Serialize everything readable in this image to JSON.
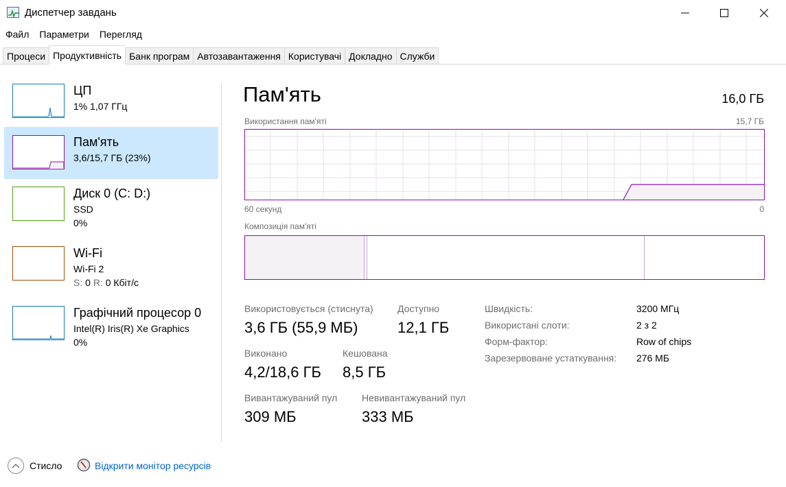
{
  "window": {
    "title": "Диспетчер завдань",
    "icon": "task-manager-icon"
  },
  "menu": [
    "Файл",
    "Параметри",
    "Перегляд"
  ],
  "tabs": [
    "Процеси",
    "Продуктивність",
    "Банк програм",
    "Автозавантаження",
    "Користувачі",
    "Докладно",
    "Служби"
  ],
  "active_tab": "Продуктивність",
  "sidebar": {
    "items": [
      {
        "title": "ЦП",
        "line1": "1%  1,07 ГГц",
        "line2": "",
        "color": "#117dbb",
        "selected": false
      },
      {
        "title": "Пам'ять",
        "line1": "3,6/15,7 ГБ (23%)",
        "line2": "",
        "color": "#8b12ae",
        "selected": true
      },
      {
        "title": "Диск 0 (C: D:)",
        "line1": "SSD",
        "line2": "0%",
        "color": "#4da60c",
        "selected": false
      },
      {
        "title": "Wi-Fi",
        "line1": "Wi-Fi 2",
        "line2_s": "S:",
        "line2_s_val": "0",
        "line2_r": "R:",
        "line2_r_val": "0 Кбіт/с",
        "color": "#a74f01",
        "selected": false
      },
      {
        "title": "Графічний процесор 0",
        "line1": "Intel(R) Iris(R) Xe Graphics",
        "line2": "0%",
        "color": "#117dbb",
        "selected": false
      }
    ]
  },
  "main": {
    "title": "Пам'ять",
    "total": "16,0 ГБ",
    "usage_label": "Використання пам'яті",
    "usage_max": "15,7 ГБ",
    "time_left": "60 секунд",
    "time_right": "0",
    "composition_label": "Композиція пам'яті",
    "accent_color": "#8b12ae"
  },
  "stats": {
    "in_use_label": "Використовується (стиснута)",
    "in_use_value": "3,6 ГБ (55,9 МБ)",
    "available_label": "Доступно",
    "available_value": "12,1 ГБ",
    "committed_label": "Виконано",
    "committed_value": "4,2/18,6 ГБ",
    "cached_label": "Кешована",
    "cached_value": "8,5 ГБ",
    "paged_label": "Вивантажуваний пул",
    "paged_value": "309 МБ",
    "nonpaged_label": "Невивантажуваний пул",
    "nonpaged_value": "333 МБ"
  },
  "info": [
    {
      "label": "Швидкість:",
      "value": "3200 МГц"
    },
    {
      "label": "Використані слоти:",
      "value": "2 з 2"
    },
    {
      "label": "Форм-фактор:",
      "value": "Row of chips"
    },
    {
      "label": "Зарезервоване устаткування:",
      "value": "276 МБ"
    }
  ],
  "footer": {
    "less_label": "Стисло",
    "monitor_link": "Відкрити монітор ресурсів"
  }
}
